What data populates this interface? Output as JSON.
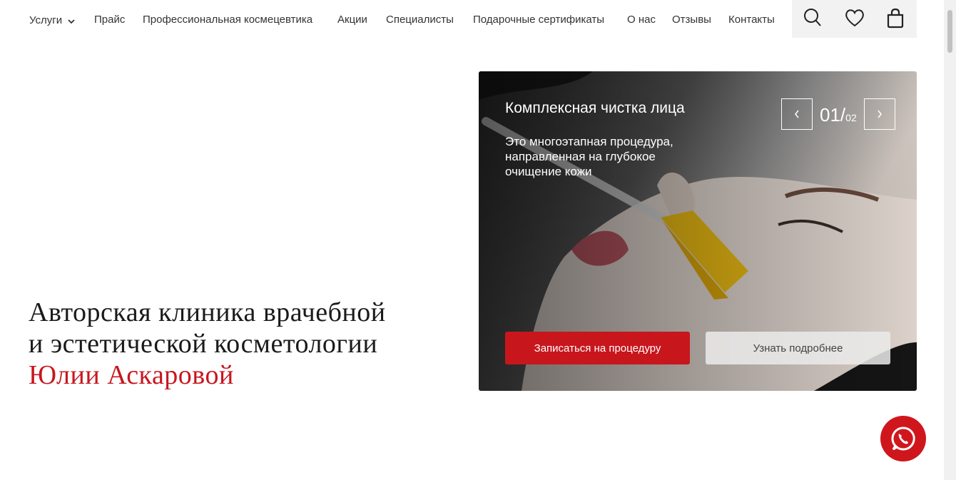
{
  "nav": {
    "items": [
      {
        "label": "Услуги"
      },
      {
        "label": "Прайс"
      },
      {
        "label": "Профессиональная космецевтика"
      },
      {
        "label": "Акции"
      },
      {
        "label": "Специалисты"
      },
      {
        "label": "Подарочные сертификаты"
      },
      {
        "label": "О нас"
      },
      {
        "label": "Отзывы"
      },
      {
        "label": "Контакты"
      }
    ],
    "icons": [
      "search-icon",
      "heart-icon",
      "bag-icon"
    ]
  },
  "hero": {
    "line1": "Авторская клиника врачебной",
    "line2": "и  эстетической косметологии",
    "line3": "Юлии Аскаровой"
  },
  "slider": {
    "title": "Комплексная чистка лица",
    "description": "Это многоэтапная процедура, направленная на глубокое очищение кожи",
    "current": "01/",
    "total": "02",
    "primary_button": "Записаться на процедуру",
    "secondary_button": "Узнать подробнее"
  },
  "colors": {
    "accent": "#c8161d",
    "icons_bg": "#f2f2f2"
  }
}
